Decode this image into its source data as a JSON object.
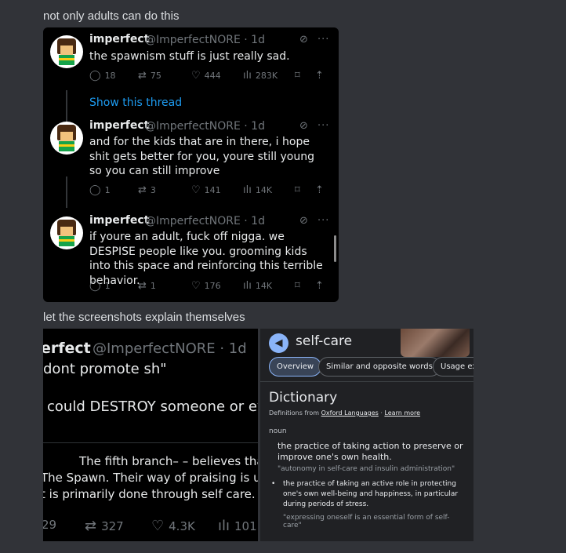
{
  "messages": {
    "first": "not only adults can do this",
    "second": "let the screenshots explain themselves"
  },
  "tweets": [
    {
      "name": "imperfect",
      "handle": "@ImperfectNORE · 1d",
      "text": "the spawnism stuff is just really sad.",
      "replies": "18",
      "reposts": "75",
      "likes": "444",
      "views": "283K"
    },
    {
      "name": "imperfect",
      "handle": "@ImperfectNORE · 1d",
      "text": "and for the kids that are in there, i hope shit gets better for you, youre still young so you can still improve",
      "replies": "1",
      "reposts": "3",
      "likes": "141",
      "views": "14K"
    },
    {
      "name": "imperfect",
      "handle": "@ImperfectNORE · 1d",
      "text": "if youre an adult, fuck off nigga. we DESPISE people like you. grooming kids into this space and reinforcing this terrible behavior.",
      "replies": "1",
      "reposts": "1",
      "likes": "176",
      "views": "14K"
    }
  ],
  "show_thread": "Show this thread",
  "zoomed_tweet": {
    "name": "erfect",
    "handle": "@ImperfectNORE · 1d",
    "line1": "dont promote sh\"",
    "line2": "could DESTROY someone or eve",
    "quote1": "The fifth branch– – believes that tl",
    "quote2": "The Spawn. Their way of praising is up to",
    "quote3": "t is primarily done through self care.",
    "replies": "29",
    "reposts": "327",
    "likes": "4.3K",
    "views": "101"
  },
  "dictionary": {
    "word": "self-care",
    "chips": [
      "Overview",
      "Similar and opposite words",
      "Usage ex"
    ],
    "title": "Dictionary",
    "source_prefix": "Definitions from",
    "source_link": "Oxford Languages",
    "learn_more": "Learn more",
    "part_of_speech": "noun",
    "def1": "the practice of taking action to preserve or improve one's own health.",
    "ex1": "\"autonomy in self-care and insulin administration\"",
    "def2": "the practice of taking an active role in protecting one's own well-being and happiness, in particular during periods of stress.",
    "ex2": "\"expressing oneself is an essential form of self-care\""
  },
  "colors": {
    "discord_bg": "#313338",
    "x_bg": "#000000",
    "x_link": "#1d9bf0",
    "google_bg": "#202124"
  }
}
